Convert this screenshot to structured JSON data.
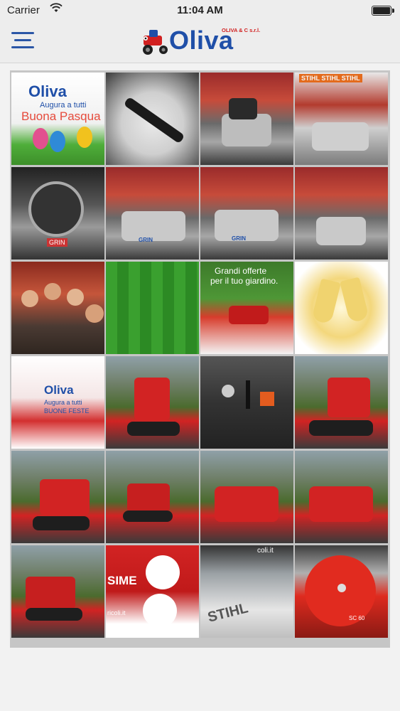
{
  "status_bar": {
    "carrier": "Carrier",
    "time": "11:04 AM",
    "battery_level": 1.0
  },
  "header": {
    "logo_brand": "Oliva",
    "logo_company": "OLIVA & C s.r.l.",
    "brand_color": "#1f4fa8",
    "accent_color": "#d12020"
  },
  "gallery": {
    "tiles": [
      {
        "label": "Oliva Augura a tutti Buona Pasqua",
        "texts": [
          "Oliva",
          "Augura a tutti",
          "Buona Pasqua"
        ]
      },
      {
        "label": "Lawnmower blade"
      },
      {
        "label": "Lawnmower in shop"
      },
      {
        "label": "Lawnmowers shop floor",
        "texts": [
          "STIHL STIHL STIHL"
        ]
      },
      {
        "label": "Mower engine",
        "texts": [
          "GRIN"
        ]
      },
      {
        "label": "Grin mower",
        "texts": [
          "GRIN"
        ]
      },
      {
        "label": "Grin mower shop",
        "texts": [
          "GRIN"
        ]
      },
      {
        "label": "Mowers lineup"
      },
      {
        "label": "Group dinner"
      },
      {
        "label": "Green lawn"
      },
      {
        "label": "Grandi offerte per il tuo giardino",
        "texts": [
          "Grandi offerte",
          "per il tuo giardino."
        ]
      },
      {
        "label": "Champagne toast"
      },
      {
        "label": "Oliva Augura a tutti Buone Feste",
        "texts": [
          "Oliva",
          "Augura a tutti",
          "BUONE FESTE"
        ]
      },
      {
        "label": "Tracked snowblower"
      },
      {
        "label": "Snowblower control panel"
      },
      {
        "label": "Red snowblower tracks"
      },
      {
        "label": "Snowblower on grass"
      },
      {
        "label": "Snowblower side view"
      },
      {
        "label": "Snowblower front view"
      },
      {
        "label": "Snowblower front view 2"
      },
      {
        "label": "Snowblower on lawn"
      },
      {
        "label": "Snowblower promo",
        "texts": [
          "SIME",
          "ricoli.it"
        ]
      },
      {
        "label": "Stihl sign",
        "texts": [
          "coli.it",
          "STIHL"
        ]
      },
      {
        "label": "Red wood chipper",
        "texts": [
          "SC 60"
        ]
      }
    ]
  }
}
